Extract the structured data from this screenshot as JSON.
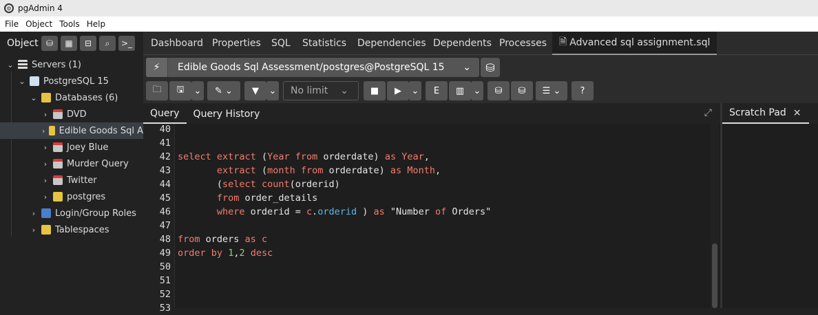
{
  "window": {
    "title": "pgAdmin 4"
  },
  "menu": [
    "File",
    "Object",
    "Tools",
    "Help"
  ],
  "object_explorer": {
    "label": "Object E..."
  },
  "main_tabs": [
    {
      "label": "Dashboard"
    },
    {
      "label": "Properties"
    },
    {
      "label": "SQL"
    },
    {
      "label": "Statistics"
    },
    {
      "label": "Dependencies"
    },
    {
      "label": "Dependents"
    },
    {
      "label": "Processes"
    },
    {
      "label": "Advanced sql assignment.sql",
      "active": true
    }
  ],
  "tree": [
    {
      "label": "Servers (1)",
      "icon": "server-icon",
      "level": 0,
      "chevron": "down"
    },
    {
      "label": "PostgreSQL 15",
      "icon": "postgres-elephant-icon",
      "level": 1,
      "chevron": "down"
    },
    {
      "label": "Databases (6)",
      "icon": "database-folder-icon",
      "level": 2,
      "chevron": "down"
    },
    {
      "label": "DVD",
      "icon": "database-icon",
      "level": 3,
      "chevron": "right"
    },
    {
      "label": "Edible Goods Sql A",
      "icon": "database-icon",
      "level": 3,
      "chevron": "right",
      "selected": true
    },
    {
      "label": "Joey Blue",
      "icon": "database-icon",
      "level": 3,
      "chevron": "right"
    },
    {
      "label": "Murder Query",
      "icon": "database-icon",
      "level": 3,
      "chevron": "right"
    },
    {
      "label": "Twitter",
      "icon": "database-icon",
      "level": 3,
      "chevron": "right"
    },
    {
      "label": "postgres",
      "icon": "database-icon",
      "level": 3,
      "chevron": "right"
    },
    {
      "label": "Login/Group Roles",
      "icon": "role-icon",
      "level": 2,
      "chevron": "right"
    },
    {
      "label": "Tablespaces",
      "icon": "tablespace-icon",
      "level": 2,
      "chevron": "right"
    }
  ],
  "query_tool": {
    "connection": "Edible Goods Sql Assessment/postgres@PostgreSQL 15",
    "limit": "No limit"
  },
  "query_tabs": [
    {
      "label": "Query",
      "active": true
    },
    {
      "label": "Query History"
    }
  ],
  "scratch_pad": {
    "label": "Scratch Pad",
    "close": "×"
  },
  "editor": {
    "line_numbers": [
      "40",
      "41",
      "42",
      "43",
      "44",
      "45",
      "46",
      "47",
      "48",
      "49",
      "50",
      "51",
      "52",
      "53"
    ],
    "lines": [
      [],
      [],
      [
        [
          "kw",
          "select"
        ],
        [
          "t",
          " "
        ],
        [
          "kw",
          "extract"
        ],
        [
          "t",
          " ("
        ],
        [
          "kw",
          "Year"
        ],
        [
          "t",
          " "
        ],
        [
          "kw",
          "from"
        ],
        [
          "t",
          " orderdate) "
        ],
        [
          "kw",
          "as"
        ],
        [
          "t",
          " "
        ],
        [
          "kw",
          "Year"
        ],
        [
          "t",
          ","
        ]
      ],
      [
        [
          "t",
          "       "
        ],
        [
          "kw",
          "extract"
        ],
        [
          "t",
          " ("
        ],
        [
          "kw",
          "month"
        ],
        [
          "t",
          " "
        ],
        [
          "kw",
          "from"
        ],
        [
          "t",
          " orderdate) "
        ],
        [
          "kw",
          "as"
        ],
        [
          "t",
          " "
        ],
        [
          "kw",
          "Month"
        ],
        [
          "t",
          ","
        ]
      ],
      [
        [
          "t",
          "       ("
        ],
        [
          "kw",
          "select"
        ],
        [
          "t",
          " "
        ],
        [
          "kw",
          "count"
        ],
        [
          "t",
          "(orderid)"
        ]
      ],
      [
        [
          "t",
          "       "
        ],
        [
          "kw",
          "from"
        ],
        [
          "t",
          " order_details"
        ]
      ],
      [
        [
          "t",
          "       "
        ],
        [
          "kw",
          "where"
        ],
        [
          "t",
          " orderid = "
        ],
        [
          "kw",
          "c"
        ],
        [
          "t",
          "."
        ],
        [
          "col",
          "orderid"
        ],
        [
          "t",
          " ) "
        ],
        [
          "kw",
          "as"
        ],
        [
          "t",
          " \"Number "
        ],
        [
          "kw",
          "of"
        ],
        [
          "t",
          " Orders\""
        ]
      ],
      [],
      [
        [
          "kw",
          "from"
        ],
        [
          "t",
          " orders "
        ],
        [
          "kw",
          "as"
        ],
        [
          "t",
          " "
        ],
        [
          "kw",
          "c"
        ]
      ],
      [
        [
          "kw",
          "order"
        ],
        [
          "t",
          " "
        ],
        [
          "kw",
          "by"
        ],
        [
          "t",
          " "
        ],
        [
          "num",
          "1"
        ],
        [
          "t",
          ","
        ],
        [
          "num",
          "2"
        ],
        [
          "t",
          " "
        ],
        [
          "kw",
          "desc"
        ]
      ],
      [],
      [],
      [],
      []
    ]
  }
}
